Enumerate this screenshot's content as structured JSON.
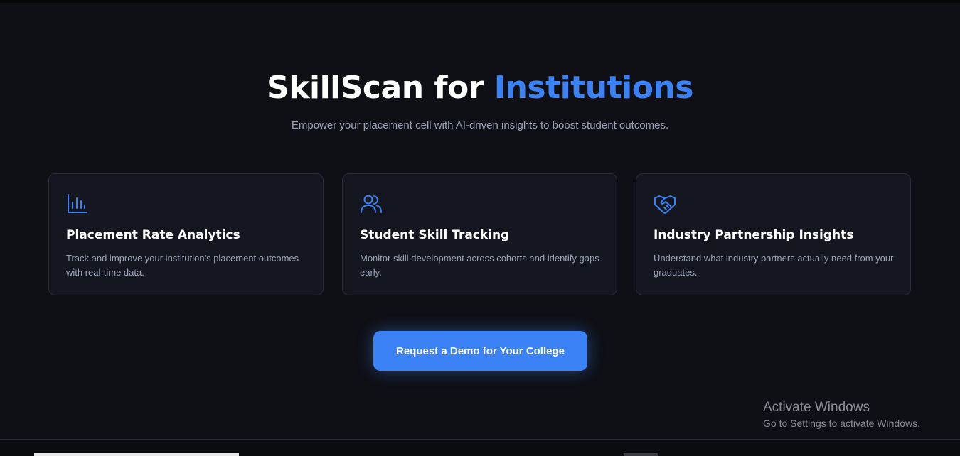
{
  "header": {
    "title_main": "SkillScan for ",
    "title_accent": "Institutions",
    "subtitle": "Empower your placement cell with AI-driven insights to boost student outcomes."
  },
  "features": [
    {
      "icon": "bar-chart-icon",
      "title": "Placement Rate Analytics",
      "description": "Track and improve your institution's placement outcomes with real-time data."
    },
    {
      "icon": "users-icon",
      "title": "Student Skill Tracking",
      "description": "Monitor skill development across cohorts and identify gaps early."
    },
    {
      "icon": "handshake-icon",
      "title": "Industry Partnership Insights",
      "description": "Understand what industry partners actually need from your graduates."
    }
  ],
  "cta": {
    "label": "Request a Demo for Your College"
  },
  "watermark": {
    "title": "Activate Windows",
    "subtitle": "Go to Settings to activate Windows."
  },
  "colors": {
    "background": "#0f1016",
    "card": "#151720",
    "accent": "#3b82f6",
    "text_muted": "#9aa3b8"
  }
}
